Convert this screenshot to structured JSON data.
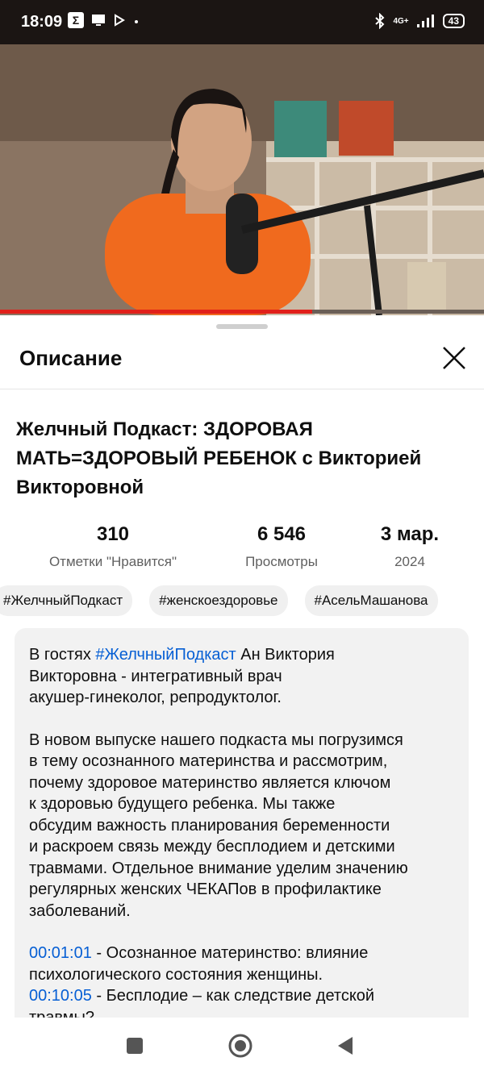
{
  "status_bar": {
    "time": "18:09",
    "network": "4G+",
    "battery": "43"
  },
  "player": {
    "progress": 0.645
  },
  "sheet": {
    "title": "Описание"
  },
  "video": {
    "title": "Желчный Подкаст: ЗДОРОВАЯ МАТЬ=ЗДОРОВЫЙ РЕБЕНОК с Викторией Викторовной"
  },
  "stats": [
    {
      "value": "310",
      "label": "Отметки \"Нравится\""
    },
    {
      "value": "6 546",
      "label": "Просмотры"
    },
    {
      "value": "3 мар.",
      "label": "2024"
    }
  ],
  "chips": [
    "#ЖелчныйПодкаст",
    "#женскоездоровье",
    "#АсельМашанова"
  ],
  "description": {
    "p1_pre": "В гостях ",
    "p1_link": "#ЖелчныйПодкаст",
    "p1_line1_rest": " Ан Виктория",
    "p1_line2": "Викторовна - интегративный врач",
    "p1_line3": "акушер-гинеколог, репродуктолог.",
    "p2_lines": [
      "В новом выпуске нашего подкаста мы погрузимся",
      "в тему осознанного материнства и рассмотрим,",
      "почему здоровое материнство является ключом",
      "к здоровью будущего ребенка. Мы также",
      "обсудим важность планирования беременности",
      "и раскроем связь между бесплодием и детскими",
      "травмами. Отдельное внимание уделим значению",
      "регулярных женских ЧЕКАПов в профилактике",
      "заболеваний."
    ],
    "ts1": "00:01:01",
    "ts1_line1": " - Осознанное материнство: влияние",
    "ts1_line2": "психологического состояния женщины.",
    "ts2": "00:10:05",
    "ts2_line1": " - Бесплодие – как следствие детской",
    "ts2_line2": "травмы?"
  },
  "icons": {
    "close": "close-icon",
    "recents": "square-icon",
    "home": "circle-icon",
    "back": "triangle-back-icon"
  },
  "colors": {
    "link": "#065fd4",
    "progress": "#e1201a",
    "shirt": "#f06a1e"
  }
}
